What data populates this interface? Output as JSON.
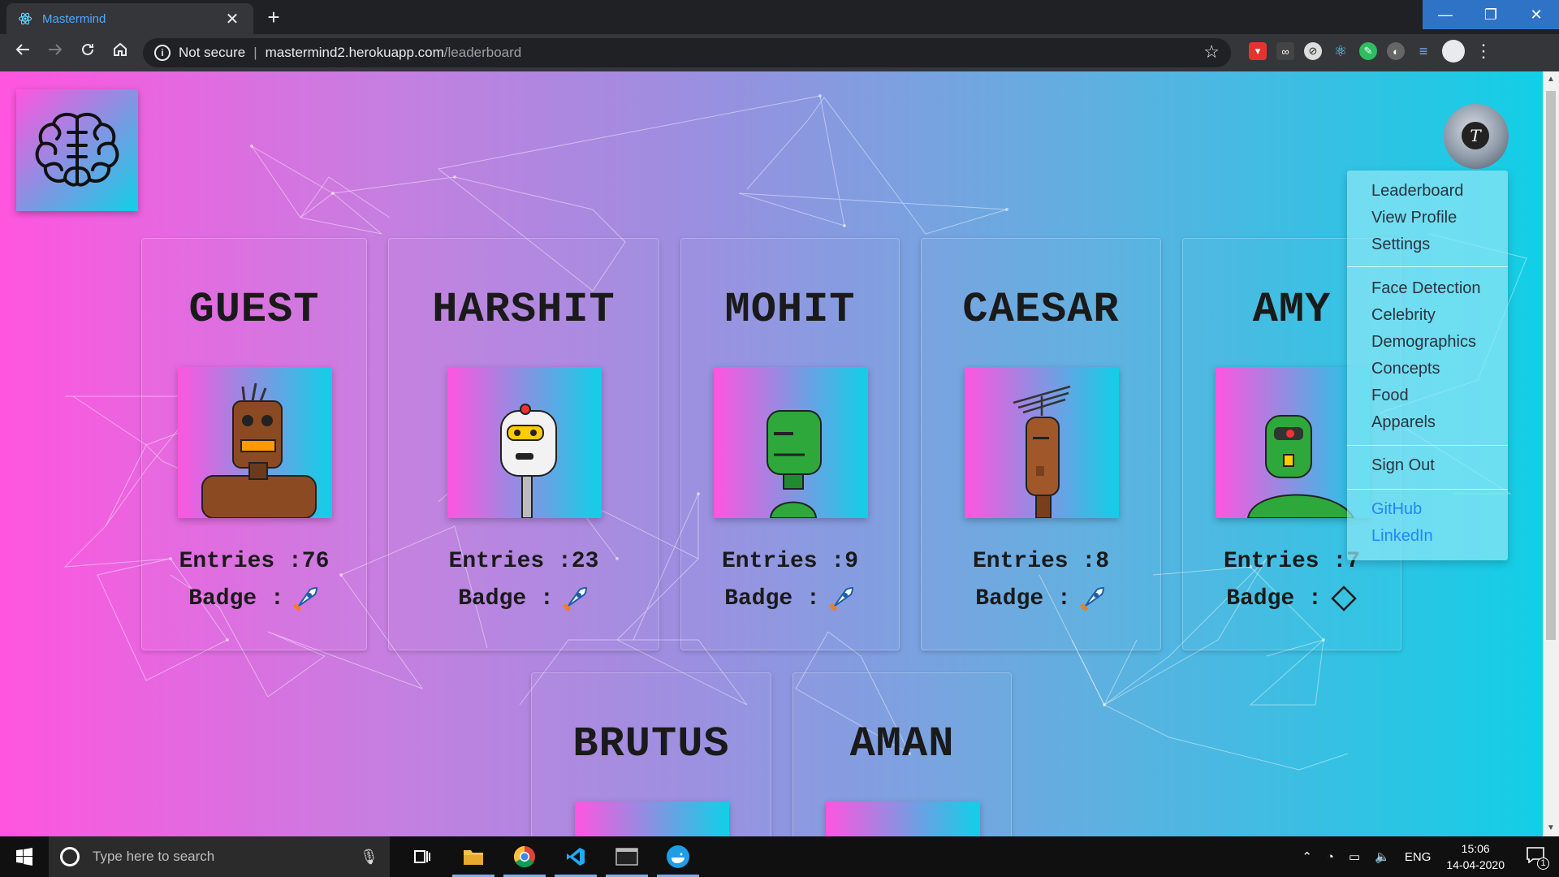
{
  "browser": {
    "tab_title": "Mastermind",
    "tab_close": "✕",
    "new_tab": "+",
    "security_label": "Not secure",
    "url_host": "mastermind2.herokuapp.com",
    "url_path": "/leaderboard",
    "win_minimize": "—",
    "win_restore": "❐",
    "win_close": "✕"
  },
  "users": [
    {
      "name": "GUEST",
      "entries_label": "Entries :76",
      "badge_label": "Badge :",
      "entries": 76,
      "badge": "rocket-icon",
      "robot_color": "#8b4a22"
    },
    {
      "name": "HARSHIT",
      "entries_label": "Entries :23",
      "badge_label": "Badge :",
      "entries": 23,
      "badge": "rocket-icon",
      "robot_color": "#f2f2f2"
    },
    {
      "name": "MOHIT",
      "entries_label": "Entries :9",
      "badge_label": "Badge :",
      "entries": 9,
      "badge": "rocket-icon",
      "robot_color": "#2ea83a"
    },
    {
      "name": "CAESAR",
      "entries_label": "Entries :8",
      "badge_label": "Badge :",
      "entries": 8,
      "badge": "rocket-icon",
      "robot_color": "#a0582a"
    },
    {
      "name": "AMY",
      "entries_label": "Entries :7",
      "badge_label": "Badge :",
      "entries": 7,
      "badge": "diamond-icon",
      "robot_color": "#2ea83a"
    },
    {
      "name": "BRUTUS"
    },
    {
      "name": "AMAN"
    }
  ],
  "avatar_letter": "T",
  "menu": {
    "leaderboard": "Leaderboard",
    "view_profile": "View Profile",
    "settings": "Settings",
    "face_detection": "Face Detection",
    "celebrity": "Celebrity",
    "demographics": "Demographics",
    "concepts": "Concepts",
    "food": "Food",
    "apparels": "Apparels",
    "sign_out": "Sign Out",
    "github": "GitHub",
    "linkedin": "LinkedIn"
  },
  "taskbar": {
    "search_placeholder": "Type here to search",
    "language": "ENG",
    "time": "15:06",
    "date": "14-04-2020",
    "notification_count": "1"
  },
  "colors": {
    "gradient_left": "#ff55df",
    "gradient_right": "#0fd0e6",
    "link": "#1f86ff",
    "tab_text": "#4fa8ff"
  }
}
